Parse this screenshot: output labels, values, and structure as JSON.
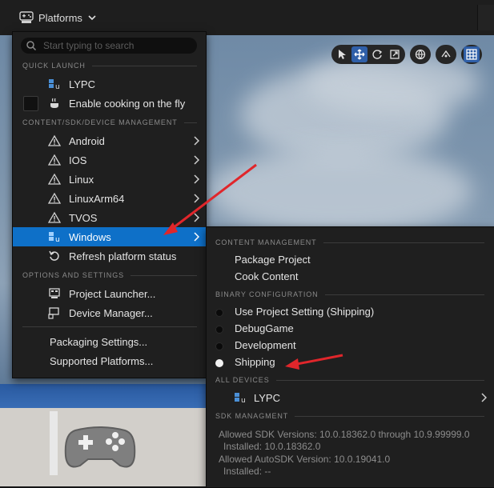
{
  "toolbar": {
    "platforms_label": "Platforms"
  },
  "search": {
    "placeholder": "Start typing to search"
  },
  "menu": {
    "quick_launch": {
      "header": "QUICK LAUNCH",
      "items": [
        {
          "label": "LYPC",
          "icon": "unreal-windows-icon"
        },
        {
          "label": "Enable cooking on the fly",
          "icon": "cook-pot-icon",
          "checked": false
        }
      ]
    },
    "content_sdk": {
      "header": "CONTENT/SDK/DEVICE MANAGEMENT",
      "items": [
        {
          "label": "Android",
          "icon": "warning-icon"
        },
        {
          "label": "IOS",
          "icon": "warning-icon"
        },
        {
          "label": "Linux",
          "icon": "warning-icon"
        },
        {
          "label": "LinuxArm64",
          "icon": "warning-icon"
        },
        {
          "label": "TVOS",
          "icon": "warning-icon"
        },
        {
          "label": "Windows",
          "icon": "unreal-windows-icon",
          "selected": true
        },
        {
          "label": "Refresh platform status",
          "icon": "refresh-icon"
        }
      ]
    },
    "options": {
      "header": "OPTIONS AND SETTINGS",
      "items": [
        {
          "label": "Project Launcher...",
          "icon": "launcher-icon"
        },
        {
          "label": "Device Manager...",
          "icon": "device-manager-icon"
        }
      ]
    },
    "footer_items": [
      {
        "label": "Packaging Settings..."
      },
      {
        "label": "Supported Platforms..."
      }
    ]
  },
  "submenu": {
    "content_management": {
      "header": "CONTENT MANAGEMENT",
      "items": [
        "Package Project",
        "Cook Content"
      ]
    },
    "binary_configuration": {
      "header": "BINARY CONFIGURATION",
      "items": [
        {
          "label": "Use Project Setting (Shipping)",
          "selected": false
        },
        {
          "label": "DebugGame",
          "selected": false
        },
        {
          "label": "Development",
          "selected": false
        },
        {
          "label": "Shipping",
          "selected": true
        }
      ]
    },
    "all_devices": {
      "header": "ALL DEVICES",
      "items": [
        {
          "label": "LYPC",
          "icon": "unreal-windows-icon"
        }
      ]
    },
    "sdk_management": {
      "header": "SDK MANAGMENT",
      "lines": [
        "Allowed SDK Versions: 10.0.18362.0 through 10.9.99999.0",
        "Installed: 10.0.18362.0",
        "Allowed AutoSDK Version: 10.0.19041.0",
        "Installed: --"
      ]
    }
  },
  "viewport_tools": [
    "select-icon",
    "translate-icon",
    "rotate-icon",
    "scale-icon",
    "world-icon",
    "surface-snap-icon",
    "grid-icon"
  ],
  "colors": {
    "selection": "#0e70c8",
    "annotation": "#e0262b",
    "menu_bg": "#1f1f1f"
  }
}
